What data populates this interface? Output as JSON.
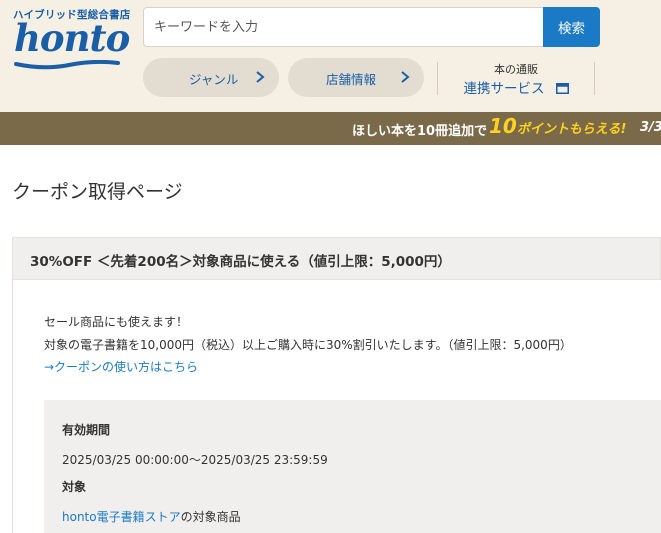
{
  "header": {
    "tagline": "ハイブリッド型総合書店",
    "logo": "honto",
    "search": {
      "placeholder": "キーワードを入力",
      "button_label": "検索"
    },
    "nav": [
      {
        "label": "ジャンル",
        "icon": "chevron-right-icon"
      },
      {
        "label": "店舗情報",
        "icon": "chevron-right-icon"
      }
    ],
    "service": {
      "small_label": "本の通販",
      "link_label": "連携サービス",
      "icon": "window-icon"
    }
  },
  "banner": {
    "text_before": "ほしい本を10冊追加で",
    "highlight_num": "10",
    "highlight_text": "ポイントもらえる!",
    "counter": "3/3"
  },
  "page": {
    "title": "クーポン取得ページ"
  },
  "coupon": {
    "title": "30%OFF ＜先着200名＞対象商品に使える（値引上限：5,000円）",
    "description": [
      "セール商品にも使えます！",
      "対象の電子書籍を10,000円（税込）以上ご購入時に30%割引いたします。（値引上限：5,000円）"
    ],
    "howto_link": "→クーポンの使い方はこちら",
    "validity_label": "有効期間",
    "validity_value": "2025/03/25 00:00:00～2025/03/25 23:59:59",
    "target_label": "対象",
    "target_link": "honto電子書籍ストア",
    "target_suffix": "の対象商品"
  },
  "colors": {
    "brand_blue": "#1a5ea8",
    "link_blue": "#1a7ac6",
    "header_bg": "#f5f0e3",
    "banner_bg": "#7a6a4a",
    "banner_highlight": "#ffd21f"
  }
}
